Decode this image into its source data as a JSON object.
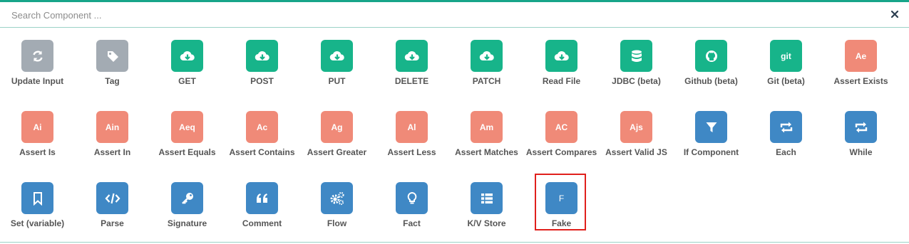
{
  "search": {
    "placeholder": "Search Component ..."
  },
  "colors": {
    "gray": "#a3abb3",
    "green": "#17b48a",
    "red": "#f08a78",
    "blue": "#3f88c5",
    "highlight": "#e0201c"
  },
  "rows": [
    [
      {
        "label": "Update Input",
        "icon": "refresh-icon",
        "color": "gray"
      },
      {
        "label": "Tag",
        "icon": "tag-icon",
        "color": "gray"
      },
      {
        "label": "GET",
        "icon": "cloud-download-icon",
        "color": "green"
      },
      {
        "label": "POST",
        "icon": "cloud-download-icon",
        "color": "green"
      },
      {
        "label": "PUT",
        "icon": "cloud-download-icon",
        "color": "green"
      },
      {
        "label": "DELETE",
        "icon": "cloud-download-icon",
        "color": "green"
      },
      {
        "label": "PATCH",
        "icon": "cloud-download-icon",
        "color": "green"
      },
      {
        "label": "Read File",
        "icon": "cloud-download-icon",
        "color": "green"
      },
      {
        "label": "JDBC (beta)",
        "icon": "database-icon",
        "color": "green"
      },
      {
        "label": "Github (beta)",
        "icon": "github-icon",
        "color": "green"
      },
      {
        "label": "Git (beta)",
        "icon": "git-text-icon",
        "text": "git",
        "color": "green"
      },
      {
        "label": "Assert Exists",
        "icon": "assert-text-icon",
        "text": "Ae",
        "color": "red"
      }
    ],
    [
      {
        "label": "Assert Is",
        "icon": "assert-text-icon",
        "text": "Ai",
        "color": "red"
      },
      {
        "label": "Assert In",
        "icon": "assert-text-icon",
        "text": "Ain",
        "color": "red"
      },
      {
        "label": "Assert Equals",
        "icon": "assert-text-icon",
        "text": "Aeq",
        "color": "red"
      },
      {
        "label": "Assert Contains",
        "icon": "assert-text-icon",
        "text": "Ac",
        "color": "red"
      },
      {
        "label": "Assert Greater",
        "icon": "assert-text-icon",
        "text": "Ag",
        "color": "red"
      },
      {
        "label": "Assert Less",
        "icon": "assert-text-icon",
        "text": "Al",
        "color": "red"
      },
      {
        "label": "Assert Matches",
        "icon": "assert-text-icon",
        "text": "Am",
        "color": "red"
      },
      {
        "label": "Assert Compares",
        "icon": "assert-text-icon",
        "text": "AC",
        "color": "red"
      },
      {
        "label": "Assert Valid JS",
        "icon": "assert-text-icon",
        "text": "Ajs",
        "color": "red"
      },
      {
        "label": "If Component",
        "icon": "filter-icon",
        "color": "blue"
      },
      {
        "label": "Each",
        "icon": "loop-icon",
        "color": "blue"
      },
      {
        "label": "While",
        "icon": "loop-icon",
        "color": "blue"
      }
    ],
    [
      {
        "label": "Set (variable)",
        "icon": "bookmark-icon",
        "color": "blue"
      },
      {
        "label": "Parse",
        "icon": "code-icon",
        "color": "blue"
      },
      {
        "label": "Signature",
        "icon": "key-icon",
        "color": "blue"
      },
      {
        "label": "Comment",
        "icon": "quote-icon",
        "color": "blue"
      },
      {
        "label": "Flow",
        "icon": "gears-icon",
        "color": "blue"
      },
      {
        "label": "Fact",
        "icon": "lightbulb-icon",
        "color": "blue"
      },
      {
        "label": "K/V Store",
        "icon": "list-icon",
        "color": "blue"
      },
      {
        "label": "Fake",
        "icon": "fake-text-icon",
        "text": "F",
        "color": "blue",
        "highlighted": true
      }
    ]
  ]
}
